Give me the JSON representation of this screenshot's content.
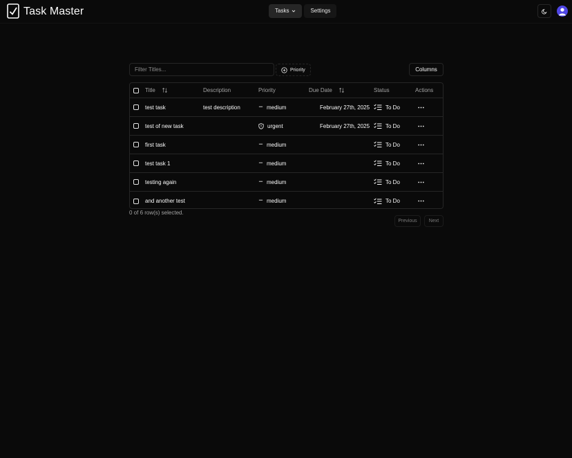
{
  "header": {
    "app_title": "Task Master",
    "nav": [
      {
        "label": "Tasks",
        "active": true
      },
      {
        "label": "Settings",
        "active": false
      }
    ]
  },
  "toolbar": {
    "filter_placeholder": "Filter Titles...",
    "filter_value": "",
    "priority_label": "Priority",
    "columns_label": "Columns"
  },
  "table": {
    "columns": {
      "title": "Title",
      "description": "Description",
      "priority": "Priority",
      "due_date": "Due Date",
      "status": "Status",
      "actions": "Actions"
    },
    "rows": [
      {
        "title": "test task",
        "description": "test description",
        "priority": "medium",
        "due_date": "February 27th, 2025",
        "status": "To Do"
      },
      {
        "title": "test of new task",
        "description": "",
        "priority": "urgent",
        "due_date": "February 27th, 2025",
        "status": "To Do"
      },
      {
        "title": "first task",
        "description": "",
        "priority": "medium",
        "due_date": "",
        "status": "To Do"
      },
      {
        "title": "test task 1",
        "description": "",
        "priority": "medium",
        "due_date": "",
        "status": "To Do"
      },
      {
        "title": "testing again",
        "description": "",
        "priority": "medium",
        "due_date": "",
        "status": "To Do"
      },
      {
        "title": "and another test",
        "description": "",
        "priority": "medium",
        "due_date": "",
        "status": "To Do"
      }
    ]
  },
  "footer": {
    "selection_text": "0 of 6 row(s) selected.",
    "previous_label": "Previous",
    "next_label": "Next"
  },
  "colors": {
    "background": "#0a0a0a",
    "border": "#262626",
    "text": "#fafafa",
    "muted": "#a3a3a3",
    "avatar": "#4f46e5"
  }
}
